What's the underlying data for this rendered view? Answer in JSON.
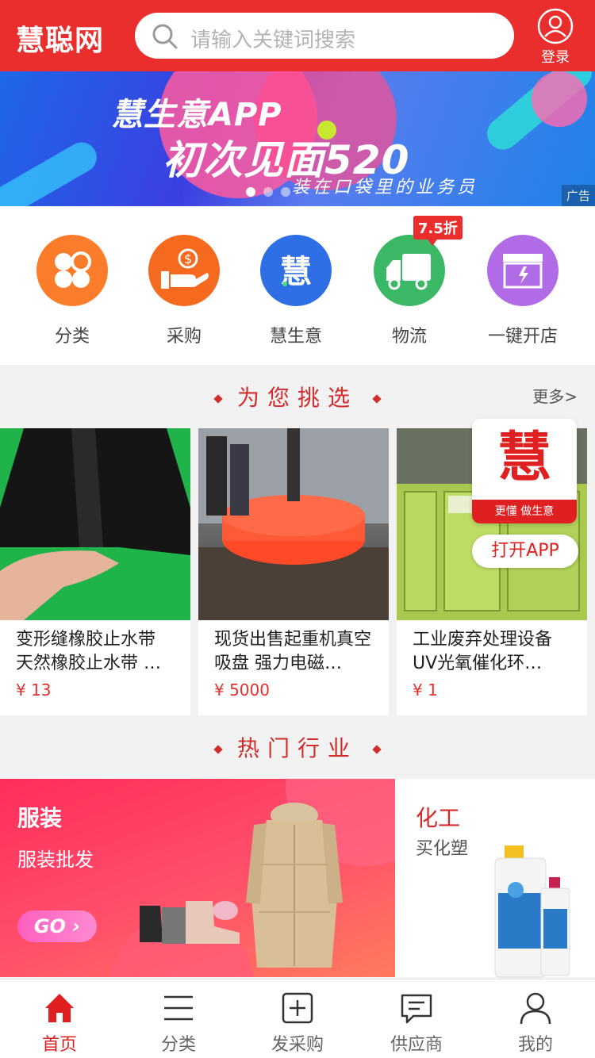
{
  "header": {
    "logo": "慧聪网",
    "search_placeholder": "请输入关键词搜索",
    "login_label": "登录"
  },
  "banner": {
    "line1": "慧生意APP",
    "line2": "初次见面520",
    "line3": "装在口袋里的业务员",
    "ad_tag": "广告"
  },
  "quick_nav": [
    {
      "label": "分类",
      "icon": "clover-icon",
      "color": "#fb7d2b"
    },
    {
      "label": "采购",
      "icon": "hand-coin-icon",
      "color": "#f56a1f"
    },
    {
      "label": "慧生意",
      "icon": "hui-logo-icon",
      "color": "#2f6fe6"
    },
    {
      "label": "物流",
      "icon": "truck-icon",
      "color": "#3bb866",
      "badge": "7.5折"
    },
    {
      "label": "一键开店",
      "icon": "store-icon",
      "color": "#b16be6"
    }
  ],
  "picks": {
    "title": "为您挑选",
    "more": "更多>",
    "products": [
      {
        "title": "变形缝橡胶止水带 天然橡胶止水带 …",
        "price": "¥ 13"
      },
      {
        "title": "现货出售起重机真空吸盘 强力电磁…",
        "price": "¥ 5000"
      },
      {
        "title": "工业废弃处理设备 UV光氧催化环…",
        "price": "¥ 1"
      }
    ]
  },
  "open_app": {
    "logo": "慧",
    "slogan": "更懂 做生意",
    "button": "打开APP"
  },
  "industry": {
    "title": "热门行业",
    "left": {
      "title": "服装",
      "sub": "服装批发",
      "go": "GO ›"
    },
    "right": {
      "title": "化工",
      "sub": "买化塑"
    }
  },
  "tabbar": [
    {
      "label": "首页",
      "icon": "home-icon",
      "active": true
    },
    {
      "label": "分类",
      "icon": "menu-icon",
      "active": false
    },
    {
      "label": "发采购",
      "icon": "plus-square-icon",
      "active": false
    },
    {
      "label": "供应商",
      "icon": "chat-icon",
      "active": false
    },
    {
      "label": "我的",
      "icon": "user-icon",
      "active": false
    }
  ],
  "colors": {
    "brand": "#ea2e2e",
    "accent_text": "#d32c2c"
  }
}
